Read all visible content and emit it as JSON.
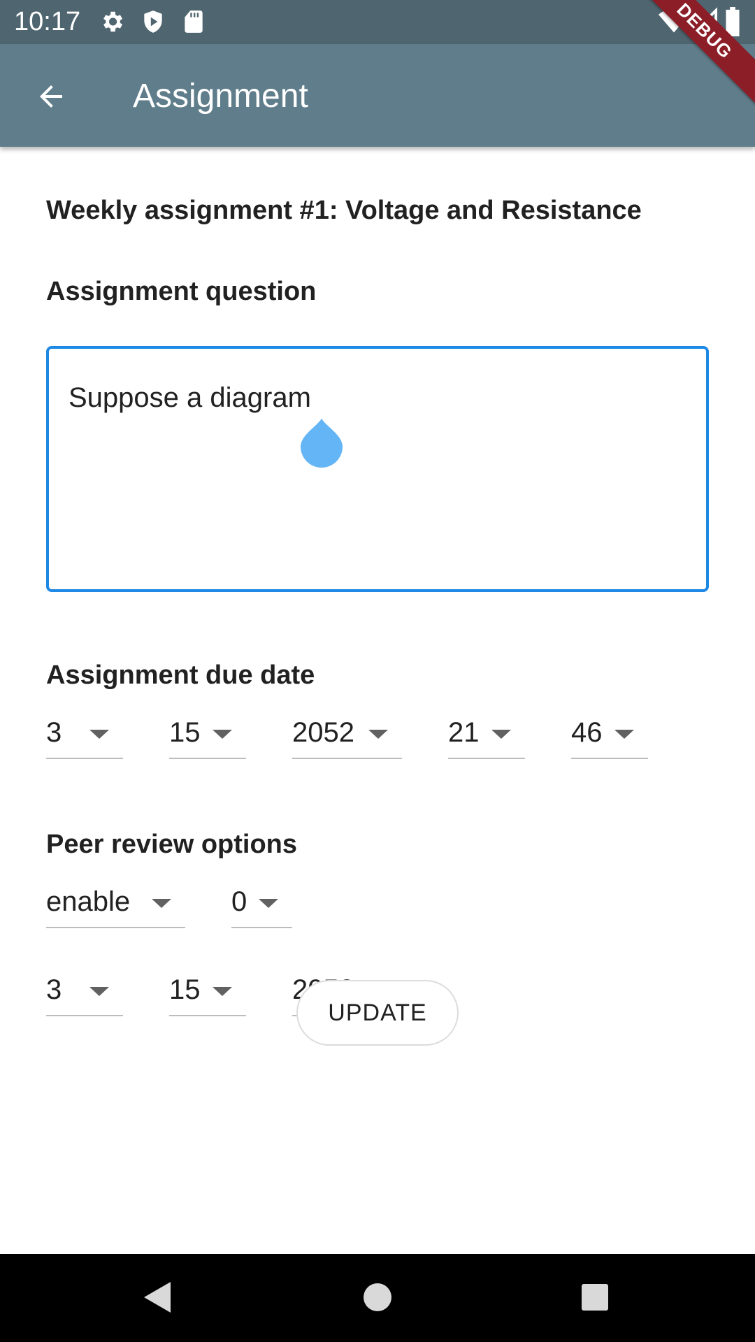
{
  "status_bar": {
    "time": "10:17",
    "icons": [
      "settings-icon",
      "shield-icon",
      "sd-card-icon",
      "wifi-icon",
      "signal-icon",
      "battery-icon"
    ]
  },
  "app_bar": {
    "title": "Assignment",
    "back_icon": "arrow-back-icon",
    "debug_banner": "DEBUG",
    "color": "#607d8b"
  },
  "assignment": {
    "title": "Weekly assignment #1: Voltage and Resistance",
    "question_label": "Assignment question",
    "question_value": "Suppose a diagram",
    "due_date_label": "Assignment due date",
    "due_date": {
      "month": "3",
      "day": "15",
      "year": "2052",
      "hour": "21",
      "minute": "46"
    },
    "peer_review_label": "Peer review options",
    "peer_review": {
      "mode": "enable",
      "count": "0",
      "month": "3",
      "day": "15",
      "year": "2052"
    },
    "update_label": "UPDATE"
  },
  "colors": {
    "accent": "#1e88e5",
    "status_bar": "#4f6570",
    "debug_ribbon": "#8b1e27"
  },
  "nav_bar": {
    "icons": [
      "back-triangle-icon",
      "home-circle-icon",
      "recents-square-icon"
    ]
  }
}
